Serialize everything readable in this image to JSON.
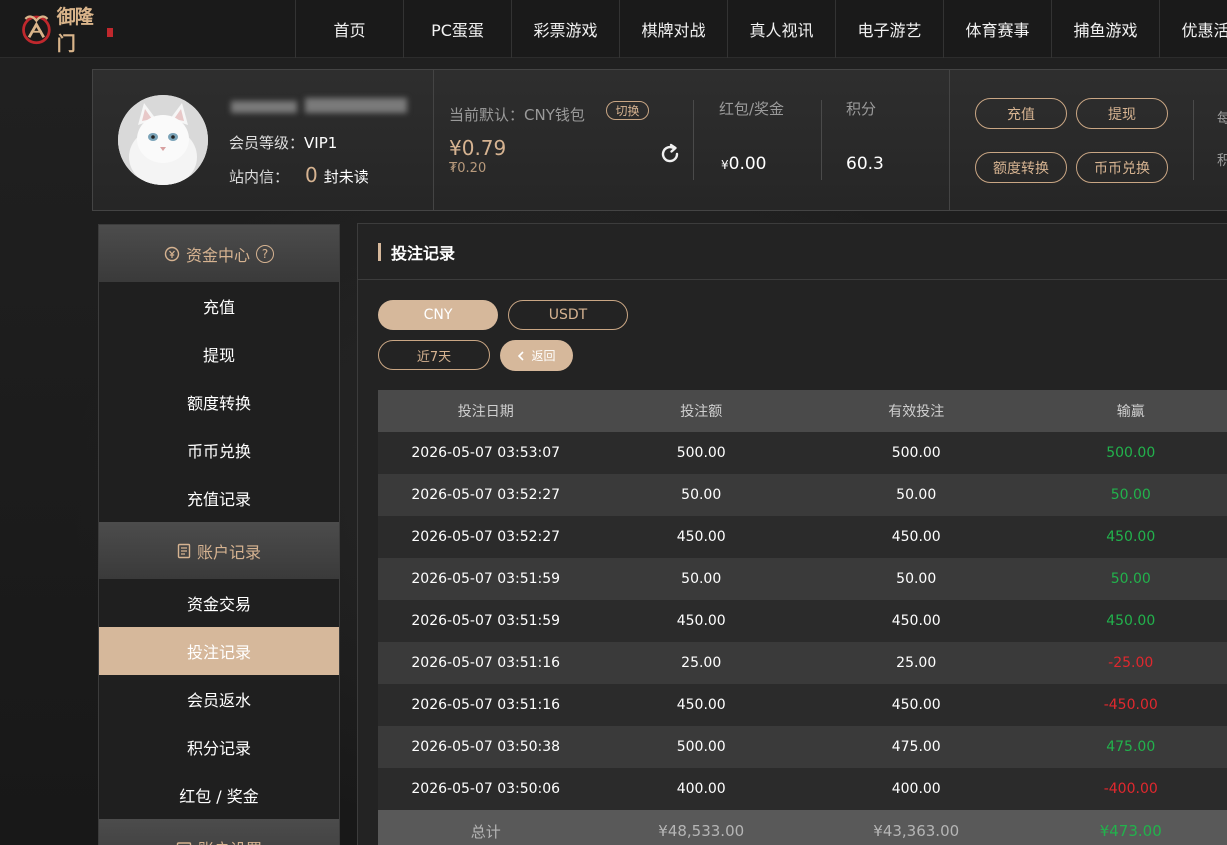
{
  "header": {
    "logo_text": "御隆门",
    "nav": [
      "首页",
      "PC蛋蛋",
      "彩票游戏",
      "棋牌对战",
      "真人视讯",
      "电子游艺",
      "体育赛事",
      "捕鱼游戏",
      "优惠活动"
    ]
  },
  "user": {
    "vip_label": "会员等级：",
    "vip_value": "VIP1",
    "msg_label": "站内信：",
    "msg_count": "0",
    "msg_suffix": "封未读"
  },
  "wallet": {
    "label": "当前默认：CNY钱包",
    "switch_label": "切换",
    "balance": "¥0.79",
    "sub_balance": "₮0.20"
  },
  "stats": {
    "bonus_label": "红包/奖金",
    "bonus_currency": "¥",
    "bonus_value": "0.00",
    "points_label": "积分",
    "points_value": "60.3"
  },
  "actions": {
    "deposit": "充值",
    "withdraw": "提现",
    "transfer": "额度转换",
    "exchange": "币币兑换",
    "edge_top": "每",
    "edge_bottom": "积"
  },
  "sidebar": {
    "fund_center": "资金中心",
    "fund_items": [
      "充值",
      "提现",
      "额度转换",
      "币币兑换",
      "充值记录"
    ],
    "account_records": "账户记录",
    "record_items": [
      "资金交易",
      "投注记录",
      "会员返水",
      "积分记录",
      "红包 / 奖金"
    ],
    "account_settings": "账户设置"
  },
  "main": {
    "title": "投注记录",
    "tab_cny": "CNY",
    "tab_usdt": "USDT",
    "range": "近7天",
    "back": "返回",
    "columns": [
      "投注日期",
      "投注额",
      "有效投注",
      "输赢"
    ],
    "rows": [
      {
        "date": "2026-05-07 03:53:07",
        "bet": "500.00",
        "valid": "500.00",
        "win": "500.00"
      },
      {
        "date": "2026-05-07 03:52:27",
        "bet": "50.00",
        "valid": "50.00",
        "win": "50.00"
      },
      {
        "date": "2026-05-07 03:52:27",
        "bet": "450.00",
        "valid": "450.00",
        "win": "450.00"
      },
      {
        "date": "2026-05-07 03:51:59",
        "bet": "50.00",
        "valid": "50.00",
        "win": "50.00"
      },
      {
        "date": "2026-05-07 03:51:59",
        "bet": "450.00",
        "valid": "450.00",
        "win": "450.00"
      },
      {
        "date": "2026-05-07 03:51:16",
        "bet": "25.00",
        "valid": "25.00",
        "win": "-25.00"
      },
      {
        "date": "2026-05-07 03:51:16",
        "bet": "450.00",
        "valid": "450.00",
        "win": "-450.00"
      },
      {
        "date": "2026-05-07 03:50:38",
        "bet": "500.00",
        "valid": "475.00",
        "win": "475.00"
      },
      {
        "date": "2026-05-07 03:50:06",
        "bet": "400.00",
        "valid": "400.00",
        "win": "-400.00"
      }
    ],
    "total": {
      "label": "总计",
      "bet": "¥48,533.00",
      "valid": "¥43,363.00",
      "win": "¥473.00"
    }
  },
  "colors": {
    "accent": "#d6b89b",
    "positive": "#22b24c",
    "negative": "#e0282e"
  }
}
